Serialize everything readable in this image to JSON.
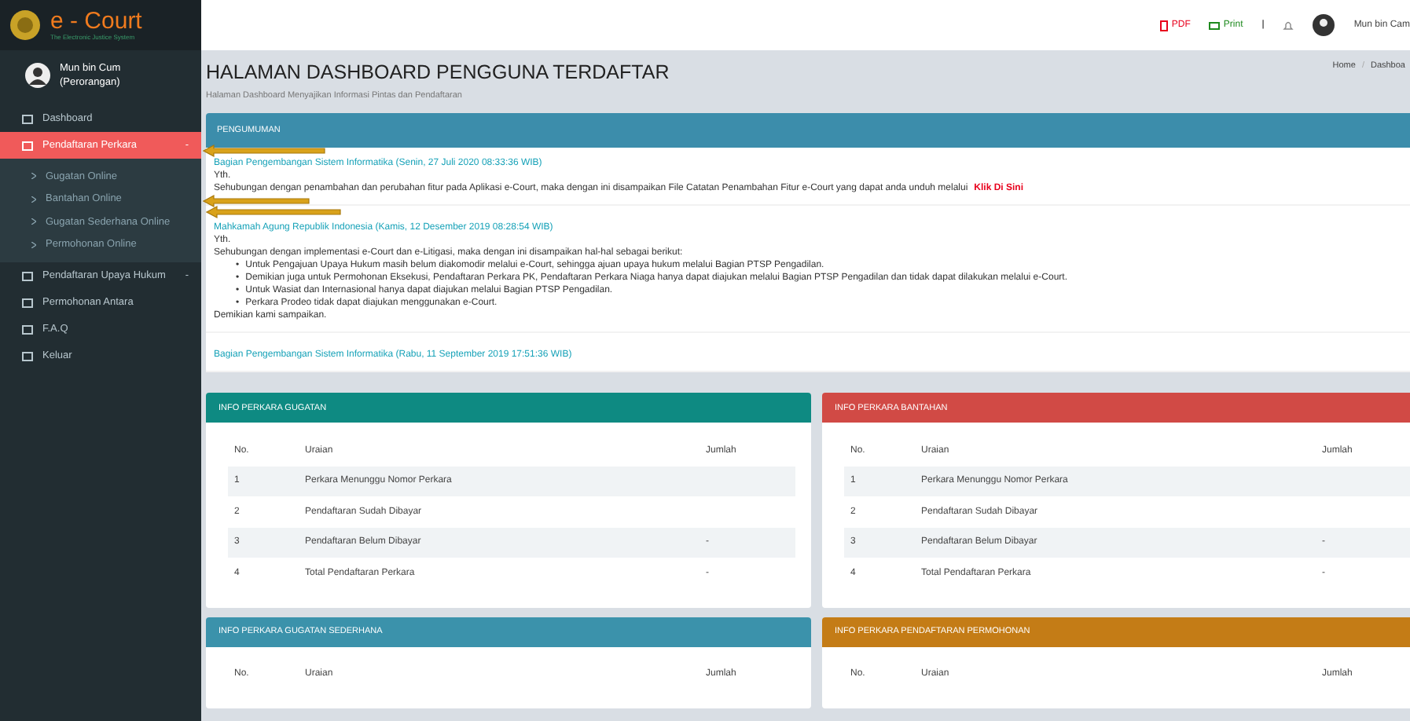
{
  "sidebar": {
    "logo": {
      "title": "e - Court",
      "subtitle": "The Electronic Justice System"
    },
    "user": {
      "name": "Mun bin Cum",
      "role": "(Perorangan)"
    },
    "menu": [
      {
        "label": "Dashboard",
        "selected": false
      },
      {
        "label": "Pendaftaran Perkara",
        "selected": true,
        "toggle": "-",
        "children": [
          {
            "label": "Gugatan Online"
          },
          {
            "label": "Bantahan Online"
          },
          {
            "label": "Gugatan Sederhana Online"
          },
          {
            "label": "Permohonan Online"
          }
        ]
      },
      {
        "label": "Pendaftaran Upaya Hukum",
        "selected": false,
        "toggle": "-"
      },
      {
        "label": "Permohonan Antara",
        "selected": false
      },
      {
        "label": "F.A.Q",
        "selected": false
      },
      {
        "label": "Keluar",
        "selected": false
      }
    ]
  },
  "topbar": {
    "pdf": "PDF",
    "print": "Print",
    "separator": "|",
    "user": "Mun bin Cam"
  },
  "header": {
    "title": "HALAMAN DASHBOARD PENGGUNA TERDAFTAR",
    "subtitle": "Halaman Dashboard Menyajikan Informasi Pintas dan Pendaftaran",
    "breadcrumb": [
      "Home",
      "Dashboa"
    ],
    "breadcrumb_separator": "/"
  },
  "announcements": {
    "title": "PENGUMUMAN",
    "items": [
      {
        "author": "Bagian Pengembangan Sistem Informatika (Senin, 27 Juli 2020 08:33:36 WIB)",
        "greeting": "Yth.",
        "body": "Sehubungan dengan penambahan dan perubahan fitur pada Aplikasi e-Court, maka dengan ini disampaikan File Catatan Penambahan Fitur e-Court yang dapat anda unduh melalui",
        "link": "Klik Di Sini"
      },
      {
        "author": "Mahkamah Agung Republik Indonesia (Kamis, 12 Desember 2019 08:28:54 WIB)",
        "greeting": "Yth.",
        "body": "Sehubungan dengan implementasi e-Court dan e-Litigasi, maka dengan ini disampaikan hal-hal sebagai berikut:",
        "bullet_marker": "•",
        "bullets": [
          "Untuk Pengajuan Upaya Hukum masih belum diakomodir melalui e-Court, sehingga ajuan upaya hukum melalui Bagian PTSP Pengadilan.",
          "Demikian juga untuk Permohonan Eksekusi, Pendaftaran Perkara PK, Pendaftaran Perkara Niaga hanya dapat diajukan melalui Bagian PTSP Pengadilan dan tidak dapat dilakukan melalui e-Court.",
          "Untuk Wasiat dan Internasional hanya dapat diajukan melalui Bagian PTSP Pengadilan.",
          "Perkara Prodeo tidak dapat diajukan menggunakan e-Court."
        ],
        "closing": "Demikian kami sampaikan."
      },
      {
        "author": "Bagian Pengembangan Sistem Informatika (Rabu, 11 September 2019 17:51:36 WIB)"
      }
    ]
  },
  "panels": [
    {
      "title": "INFO PERKARA GUGATAN",
      "color": "#0e8a82",
      "columns": [
        "No.",
        "Uraian",
        "Jumlah"
      ],
      "rows": [
        {
          "no": "1",
          "label": "Perkara Menunggu Nomor Perkara"
        },
        {
          "no": "2",
          "label": "Pendaftaran Sudah Dibayar"
        },
        {
          "no": "3",
          "label": "Pendaftaran Belum Dibayar",
          "count": "-"
        },
        {
          "no": "4",
          "label": "Total Pendaftaran Perkara",
          "count": "-"
        }
      ]
    },
    {
      "title": "INFO PERKARA BANTAHAN",
      "color": "#d14a45",
      "columns": [
        "No.",
        "Uraian",
        "Jumlah"
      ],
      "rows": [
        {
          "no": "1",
          "label": "Perkara Menunggu Nomor Perkara"
        },
        {
          "no": "2",
          "label": "Pendaftaran Sudah Dibayar"
        },
        {
          "no": "3",
          "label": "Pendaftaran Belum Dibayar",
          "count": "-"
        },
        {
          "no": "4",
          "label": "Total Pendaftaran Perkara",
          "count": "-"
        }
      ]
    },
    {
      "title": "INFO PERKARA GUGATAN SEDERHANA",
      "color": "#3b92ab",
      "columns": [
        "No.",
        "Uraian",
        "Jumlah"
      ]
    },
    {
      "title": "INFO PERKARA PENDAFTARAN PERMOHONAN",
      "color": "#c47c16",
      "columns": [
        "No.",
        "Uraian",
        "Jumlah"
      ]
    }
  ]
}
